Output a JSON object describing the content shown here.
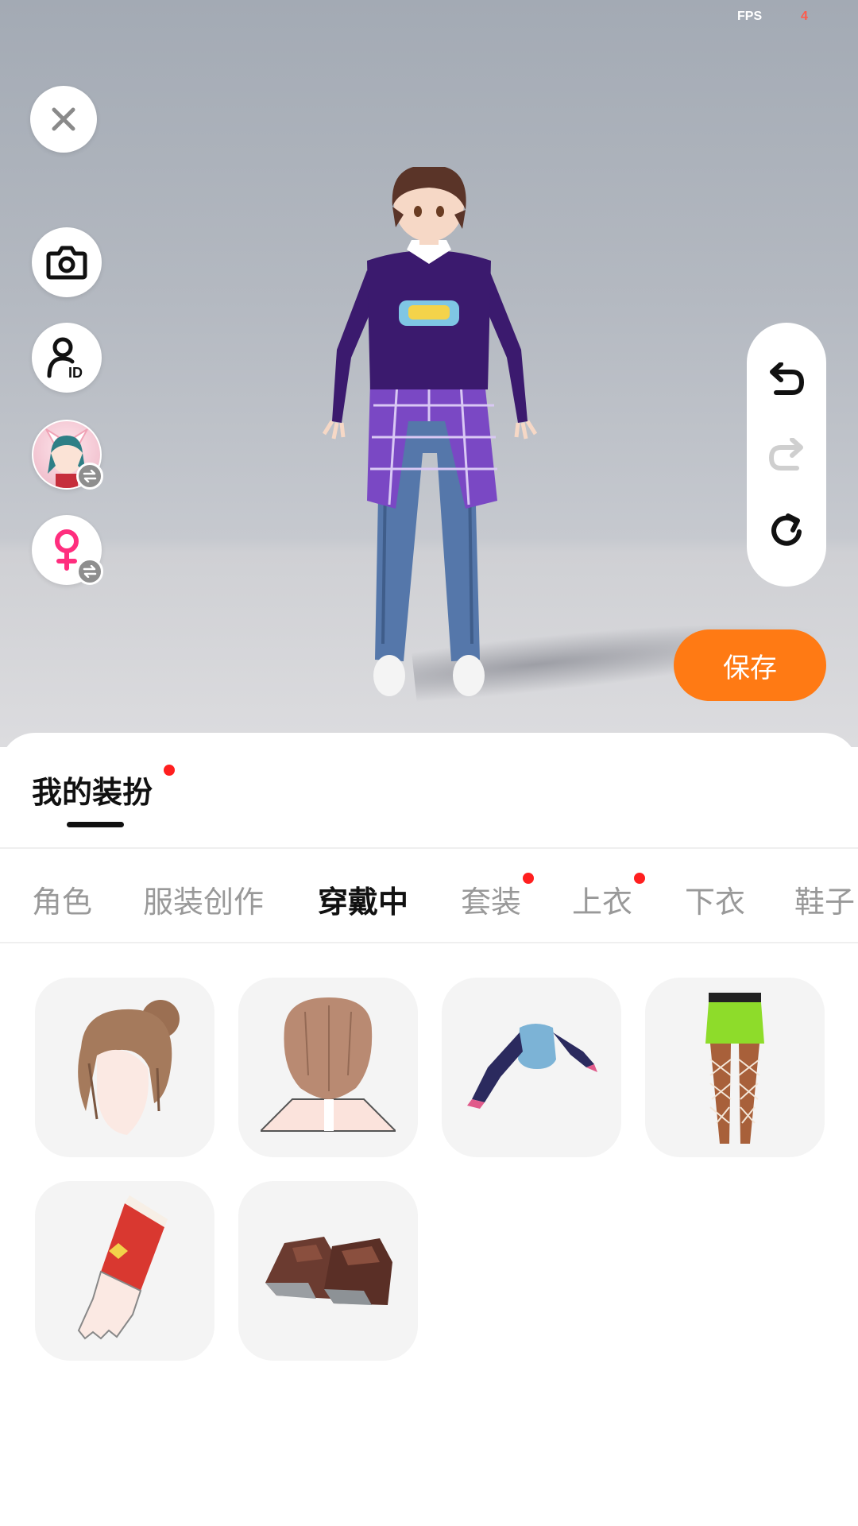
{
  "hud": {
    "fps_label": "FPS",
    "fps_value": "4"
  },
  "left_toolbar": {
    "close_icon": "close-icon",
    "camera_icon": "camera-icon",
    "id_icon": "user-id-icon",
    "avatar_icon": "character-avatar-icon",
    "gender_icon": "female-icon",
    "swap_icon": "swap-icon"
  },
  "history": {
    "undo_icon": "undo-icon",
    "redo_icon": "redo-icon",
    "reset_icon": "reset-icon"
  },
  "save_button": {
    "label": "保存",
    "color": "#ff7a14"
  },
  "sheet": {
    "title": "我的装扮",
    "title_has_dot": true,
    "tabs": [
      {
        "label": "角色",
        "active": false,
        "dot": false
      },
      {
        "label": "服装创作",
        "active": false,
        "dot": false
      },
      {
        "label": "穿戴中",
        "active": true,
        "dot": false
      },
      {
        "label": "套装",
        "active": false,
        "dot": true
      },
      {
        "label": "上衣",
        "active": false,
        "dot": true
      },
      {
        "label": "下衣",
        "active": false,
        "dot": false
      },
      {
        "label": "鞋子",
        "active": false,
        "dot": false
      }
    ],
    "items": [
      {
        "icon": "hair-bun-icon"
      },
      {
        "icon": "hair-back-icon"
      },
      {
        "icon": "crop-top-icon"
      },
      {
        "icon": "skirt-fishnet-icon"
      },
      {
        "icon": "glove-icon"
      },
      {
        "icon": "shoes-icon"
      }
    ]
  },
  "colors": {
    "accent": "#ff7a14",
    "badge_dot": "#ff1f1f",
    "tile_bg": "#f4f4f4"
  }
}
